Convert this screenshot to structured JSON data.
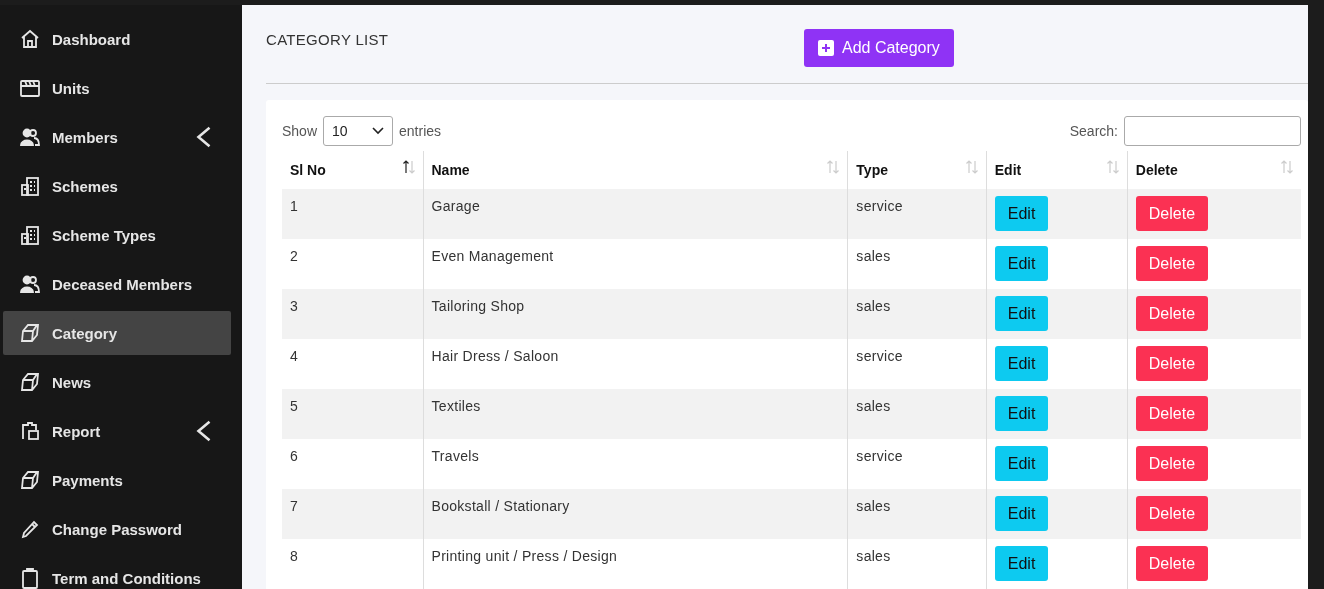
{
  "sidebar": {
    "items": [
      {
        "label": "Dashboard",
        "selected": false,
        "has_submenu": false
      },
      {
        "label": "Units",
        "selected": false,
        "has_submenu": false
      },
      {
        "label": "Members",
        "selected": false,
        "has_submenu": true
      },
      {
        "label": "Schemes",
        "selected": false,
        "has_submenu": false
      },
      {
        "label": "Scheme Types",
        "selected": false,
        "has_submenu": false
      },
      {
        "label": "Deceased Members",
        "selected": false,
        "has_submenu": false
      },
      {
        "label": "Category",
        "selected": true,
        "has_submenu": false
      },
      {
        "label": "News",
        "selected": false,
        "has_submenu": false
      },
      {
        "label": "Report",
        "selected": false,
        "has_submenu": true
      },
      {
        "label": "Payments",
        "selected": false,
        "has_submenu": false
      },
      {
        "label": "Change Password",
        "selected": false,
        "has_submenu": false
      },
      {
        "label": "Term and Conditions",
        "selected": false,
        "has_submenu": false
      }
    ]
  },
  "page": {
    "title": "CATEGORY LIST",
    "add_button": "Add Category"
  },
  "table_controls": {
    "show_label": "Show",
    "page_size": "10",
    "entries_label": "entries",
    "search_label": "Search:"
  },
  "table": {
    "columns": [
      {
        "label": "Sl No",
        "sorted": true
      },
      {
        "label": "Name",
        "sorted": false
      },
      {
        "label": "Type",
        "sorted": false
      },
      {
        "label": "Edit",
        "sorted": false
      },
      {
        "label": "Delete",
        "sorted": false
      }
    ],
    "rows": [
      {
        "sl_no": "1",
        "name": "Garage",
        "type": "service",
        "edit": "Edit",
        "delete": "Delete"
      },
      {
        "sl_no": "2",
        "name": "Even Management",
        "type": "sales",
        "edit": "Edit",
        "delete": "Delete"
      },
      {
        "sl_no": "3",
        "name": "Tailoring Shop",
        "type": "sales",
        "edit": "Edit",
        "delete": "Delete"
      },
      {
        "sl_no": "4",
        "name": "Hair Dress / Saloon",
        "type": "service",
        "edit": "Edit",
        "delete": "Delete"
      },
      {
        "sl_no": "5",
        "name": "Textiles",
        "type": "sales",
        "edit": "Edit",
        "delete": "Delete"
      },
      {
        "sl_no": "6",
        "name": "Travels",
        "type": "service",
        "edit": "Edit",
        "delete": "Delete"
      },
      {
        "sl_no": "7",
        "name": "Bookstall / Stationary",
        "type": "sales",
        "edit": "Edit",
        "delete": "Delete"
      },
      {
        "sl_no": "8",
        "name": "Printing unit / Press / Design",
        "type": "sales",
        "edit": "Edit",
        "delete": "Delete"
      }
    ]
  }
}
